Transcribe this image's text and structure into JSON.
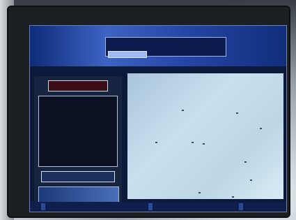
{
  "header": {
    "title_line1": "",
    "title_line2": ""
  },
  "left_panel": {
    "info_title": "",
    "info_lines": [
      "",
      "",
      "",
      "",
      "",
      "",
      ""
    ],
    "button_label": ""
  },
  "status_bar": {
    "left_text": "",
    "middle_text": "",
    "right_text": ""
  },
  "colors": {
    "accent": "#2546a6",
    "content_bg": "#c9e0ee",
    "panel_bg": "#17243f"
  }
}
